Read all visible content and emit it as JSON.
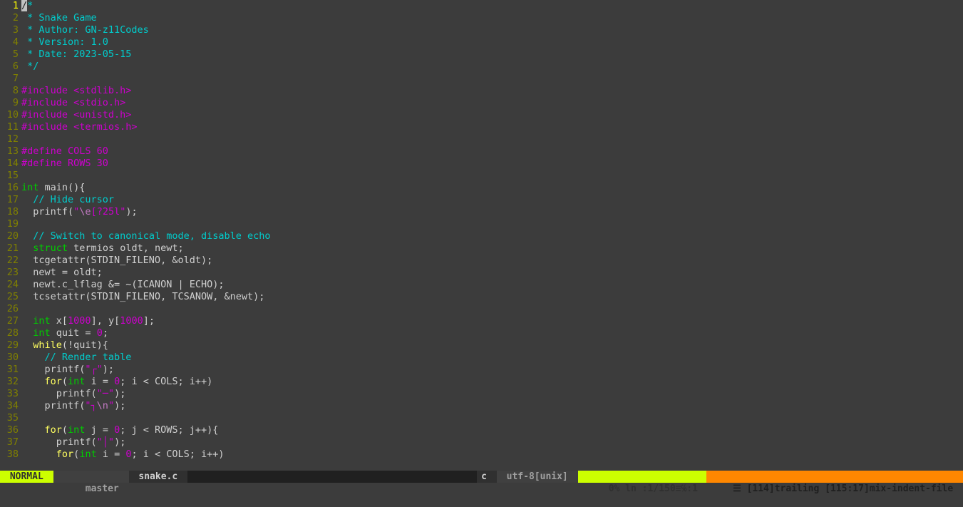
{
  "editor": {
    "filename": "snake.c",
    "cursor_line": 1,
    "lines": [
      {
        "n": 1,
        "tokens": [
          {
            "t": "/",
            "cls": "cursor"
          },
          {
            "t": "*",
            "cls": "cmt"
          }
        ]
      },
      {
        "n": 2,
        "tokens": [
          {
            "t": " * Snake Game",
            "cls": "cmt"
          }
        ]
      },
      {
        "n": 3,
        "tokens": [
          {
            "t": " * Author: GN-z11Codes",
            "cls": "cmt"
          }
        ]
      },
      {
        "n": 4,
        "tokens": [
          {
            "t": " * Version: 1.0",
            "cls": "cmt"
          }
        ]
      },
      {
        "n": 5,
        "tokens": [
          {
            "t": " * Date: 2023-05-15",
            "cls": "cmt"
          }
        ]
      },
      {
        "n": 6,
        "tokens": [
          {
            "t": " */",
            "cls": "cmt"
          }
        ]
      },
      {
        "n": 7,
        "tokens": []
      },
      {
        "n": 8,
        "tokens": [
          {
            "t": "#include ",
            "cls": "prep"
          },
          {
            "t": "<stdlib.h>",
            "cls": "hdr"
          }
        ]
      },
      {
        "n": 9,
        "tokens": [
          {
            "t": "#include ",
            "cls": "prep"
          },
          {
            "t": "<stdio.h>",
            "cls": "hdr"
          }
        ]
      },
      {
        "n": 10,
        "tokens": [
          {
            "t": "#include ",
            "cls": "prep"
          },
          {
            "t": "<unistd.h>",
            "cls": "hdr"
          }
        ]
      },
      {
        "n": 11,
        "tokens": [
          {
            "t": "#include ",
            "cls": "prep"
          },
          {
            "t": "<termios.h>",
            "cls": "hdr"
          }
        ]
      },
      {
        "n": 12,
        "tokens": []
      },
      {
        "n": 13,
        "tokens": [
          {
            "t": "#define COLS ",
            "cls": "prep"
          },
          {
            "t": "60",
            "cls": "num"
          }
        ]
      },
      {
        "n": 14,
        "tokens": [
          {
            "t": "#define ROWS ",
            "cls": "prep"
          },
          {
            "t": "30",
            "cls": "num"
          }
        ]
      },
      {
        "n": 15,
        "tokens": []
      },
      {
        "n": 16,
        "tokens": [
          {
            "t": "int",
            "cls": "ty"
          },
          {
            "t": " ",
            "cls": "op"
          },
          {
            "t": "main",
            "cls": "ident"
          },
          {
            "t": "(){",
            "cls": "op"
          }
        ]
      },
      {
        "n": 17,
        "tokens": [
          {
            "t": "  ",
            "cls": "op"
          },
          {
            "t": "// Hide cursor",
            "cls": "cmt"
          }
        ]
      },
      {
        "n": 18,
        "tokens": [
          {
            "t": "  printf(",
            "cls": "ident"
          },
          {
            "t": "\"",
            "cls": "str"
          },
          {
            "t": "\\e",
            "cls": "esc"
          },
          {
            "t": "[?25l",
            "cls": "str"
          },
          {
            "t": "\"",
            "cls": "str"
          },
          {
            "t": ");",
            "cls": "op"
          }
        ]
      },
      {
        "n": 19,
        "tokens": []
      },
      {
        "n": 20,
        "tokens": [
          {
            "t": "  ",
            "cls": "op"
          },
          {
            "t": "// Switch to canonical mode, disable echo",
            "cls": "cmt"
          }
        ]
      },
      {
        "n": 21,
        "tokens": [
          {
            "t": "  ",
            "cls": "op"
          },
          {
            "t": "struct",
            "cls": "ty"
          },
          {
            "t": " termios oldt, newt;",
            "cls": "ident"
          }
        ]
      },
      {
        "n": 22,
        "tokens": [
          {
            "t": "  tcgetattr(STDIN_FILENO, &oldt);",
            "cls": "ident"
          }
        ]
      },
      {
        "n": 23,
        "tokens": [
          {
            "t": "  newt = oldt;",
            "cls": "ident"
          }
        ]
      },
      {
        "n": 24,
        "tokens": [
          {
            "t": "  newt.c_lflag &= ~(ICANON | ECHO);",
            "cls": "ident"
          }
        ]
      },
      {
        "n": 25,
        "tokens": [
          {
            "t": "  tcsetattr(STDIN_FILENO, TCSANOW, &newt);",
            "cls": "ident"
          }
        ]
      },
      {
        "n": 26,
        "tokens": []
      },
      {
        "n": 27,
        "tokens": [
          {
            "t": "  ",
            "cls": "op"
          },
          {
            "t": "int",
            "cls": "ty"
          },
          {
            "t": " x[",
            "cls": "ident"
          },
          {
            "t": "1000",
            "cls": "num"
          },
          {
            "t": "], y[",
            "cls": "ident"
          },
          {
            "t": "1000",
            "cls": "num"
          },
          {
            "t": "];",
            "cls": "ident"
          }
        ]
      },
      {
        "n": 28,
        "tokens": [
          {
            "t": "  ",
            "cls": "op"
          },
          {
            "t": "int",
            "cls": "ty"
          },
          {
            "t": " quit = ",
            "cls": "ident"
          },
          {
            "t": "0",
            "cls": "num"
          },
          {
            "t": ";",
            "cls": "op"
          }
        ]
      },
      {
        "n": 29,
        "tokens": [
          {
            "t": "  ",
            "cls": "op"
          },
          {
            "t": "while",
            "cls": "kw"
          },
          {
            "t": "(!quit){",
            "cls": "ident"
          }
        ]
      },
      {
        "n": 30,
        "tokens": [
          {
            "t": "    ",
            "cls": "op"
          },
          {
            "t": "// Render table",
            "cls": "cmt"
          }
        ]
      },
      {
        "n": 31,
        "tokens": [
          {
            "t": "    printf(",
            "cls": "ident"
          },
          {
            "t": "\"┌\"",
            "cls": "str"
          },
          {
            "t": ");",
            "cls": "op"
          }
        ]
      },
      {
        "n": 32,
        "tokens": [
          {
            "t": "    ",
            "cls": "op"
          },
          {
            "t": "for",
            "cls": "kw"
          },
          {
            "t": "(",
            "cls": "op"
          },
          {
            "t": "int",
            "cls": "ty"
          },
          {
            "t": " i = ",
            "cls": "ident"
          },
          {
            "t": "0",
            "cls": "num"
          },
          {
            "t": "; i < COLS; i++)",
            "cls": "ident"
          }
        ]
      },
      {
        "n": 33,
        "tokens": [
          {
            "t": "      printf(",
            "cls": "ident"
          },
          {
            "t": "\"─\"",
            "cls": "str"
          },
          {
            "t": ");",
            "cls": "op"
          }
        ]
      },
      {
        "n": 34,
        "tokens": [
          {
            "t": "    printf(",
            "cls": "ident"
          },
          {
            "t": "\"┐",
            "cls": "str"
          },
          {
            "t": "\\n",
            "cls": "esc"
          },
          {
            "t": "\"",
            "cls": "str"
          },
          {
            "t": ");",
            "cls": "op"
          }
        ]
      },
      {
        "n": 35,
        "tokens": []
      },
      {
        "n": 36,
        "tokens": [
          {
            "t": "    ",
            "cls": "op"
          },
          {
            "t": "for",
            "cls": "kw"
          },
          {
            "t": "(",
            "cls": "op"
          },
          {
            "t": "int",
            "cls": "ty"
          },
          {
            "t": " j = ",
            "cls": "ident"
          },
          {
            "t": "0",
            "cls": "num"
          },
          {
            "t": "; j < ROWS; j++){",
            "cls": "ident"
          }
        ]
      },
      {
        "n": 37,
        "tokens": [
          {
            "t": "      printf(",
            "cls": "ident"
          },
          {
            "t": "\"│\"",
            "cls": "str"
          },
          {
            "t": ");",
            "cls": "op"
          }
        ]
      },
      {
        "n": 38,
        "tokens": [
          {
            "t": "      ",
            "cls": "op"
          },
          {
            "t": "for",
            "cls": "kw"
          },
          {
            "t": "(",
            "cls": "op"
          },
          {
            "t": "int",
            "cls": "ty"
          },
          {
            "t": " i = ",
            "cls": "ident"
          },
          {
            "t": "0",
            "cls": "num"
          },
          {
            "t": "; i < COLS; i++)",
            "cls": "ident"
          }
        ]
      }
    ]
  },
  "statusline": {
    "mode": " NORMAL ",
    "branch_icon": "",
    "branch": " master ",
    "filename": " snake.c ",
    "filetype": "c ",
    "encoding": " utf-8[unix] ",
    "percent": " 0% ",
    "position": "ln :1/150≡℅:1 ",
    "warn_prefix": "☰ ",
    "warning": "[114]trailing [115:17]mix-indent-file "
  }
}
